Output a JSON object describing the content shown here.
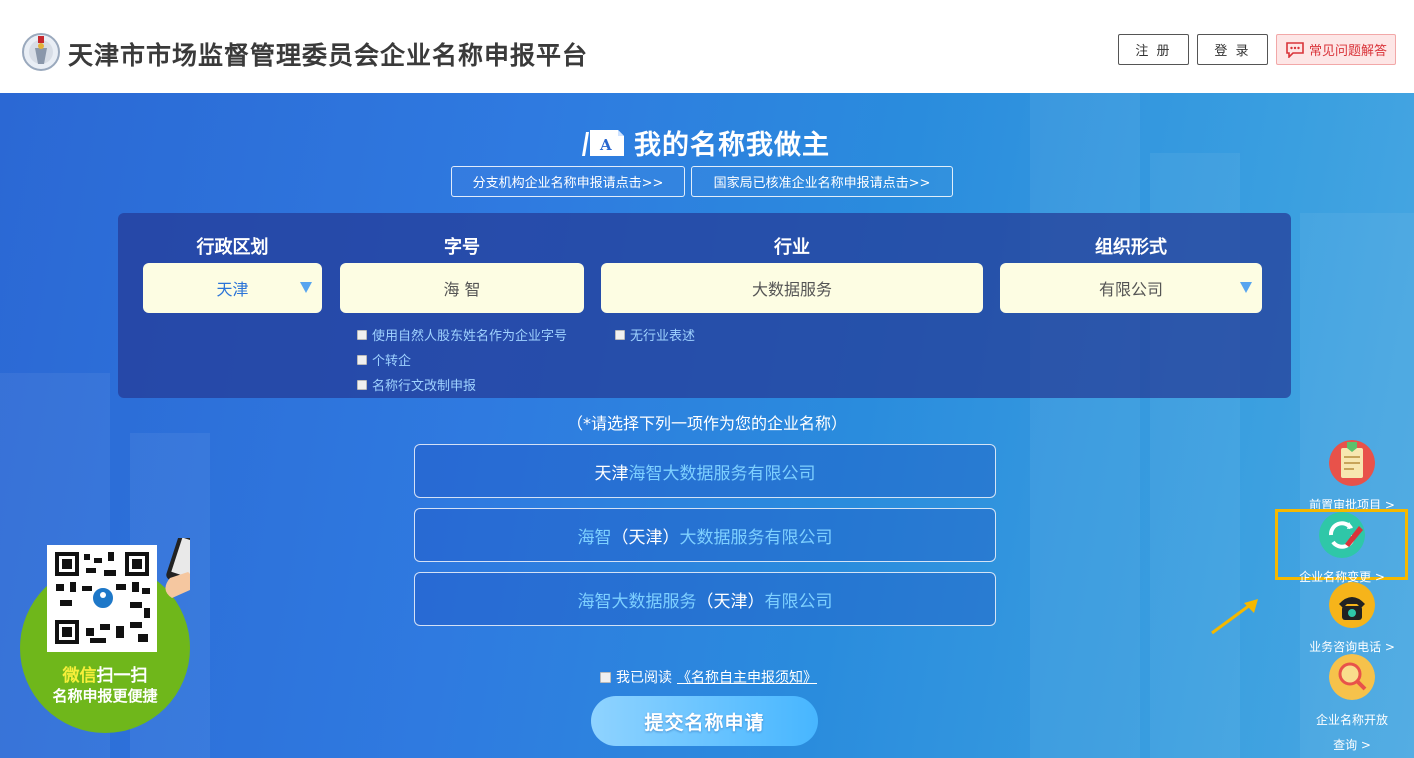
{
  "header": {
    "title": "天津市市场监督管理委员会企业名称申报平台",
    "register_label": "注 册",
    "login_label": "登 录",
    "faq_label": "常见问题解答"
  },
  "hero": {
    "slogan": "我的名称我做主",
    "branch_link": "分支机构企业名称申报请点击>>",
    "national_link": "国家局已核准企业名称申报请点击>>"
  },
  "form": {
    "labels": {
      "region": "行政区划",
      "brand": "字号",
      "industry": "行业",
      "org_form": "组织形式"
    },
    "values": {
      "region": "天津",
      "brand": "海 智",
      "industry": "大数据服务",
      "org_form": "有限公司"
    },
    "checkboxes": {
      "use_shareholder_name": "使用自然人股东姓名作为企业字号",
      "individual_to_enterprise": "个转企",
      "admin_rename": "名称行文改制申报",
      "no_industry": "无行业表述"
    }
  },
  "hint": "（*请选择下列一项作为您的企业名称）",
  "name_options": [
    {
      "part1": "天津",
      "part2": "海智大数据服务有限公司"
    },
    {
      "part1": "海智",
      "part2": "（天津）",
      "part3": "大数据服务有限公司"
    },
    {
      "part1": "海智大数据服务",
      "part2": "（天津）",
      "part3": "有限公司"
    }
  ],
  "agree": {
    "prefix": "我已阅读",
    "link": "《名称自主申报须知》"
  },
  "submit_label": "提交名称申请",
  "qr": {
    "line1_a": "微信",
    "line1_b": "扫一扫",
    "line2": "名称申报更便捷"
  },
  "side_tools": {
    "pre_approval": "前置审批项目 >",
    "name_change": "企业名称变更 >",
    "consult_phone": "业务咨询电话 >",
    "open_query_1": "企业名称开放",
    "open_query_2": "查询 >"
  },
  "colors": {
    "accent_yellow": "#f5b800",
    "field_bg": "#fdfde3",
    "option_text_blue": "#7ed0ff",
    "faq_red": "#d9343a"
  }
}
